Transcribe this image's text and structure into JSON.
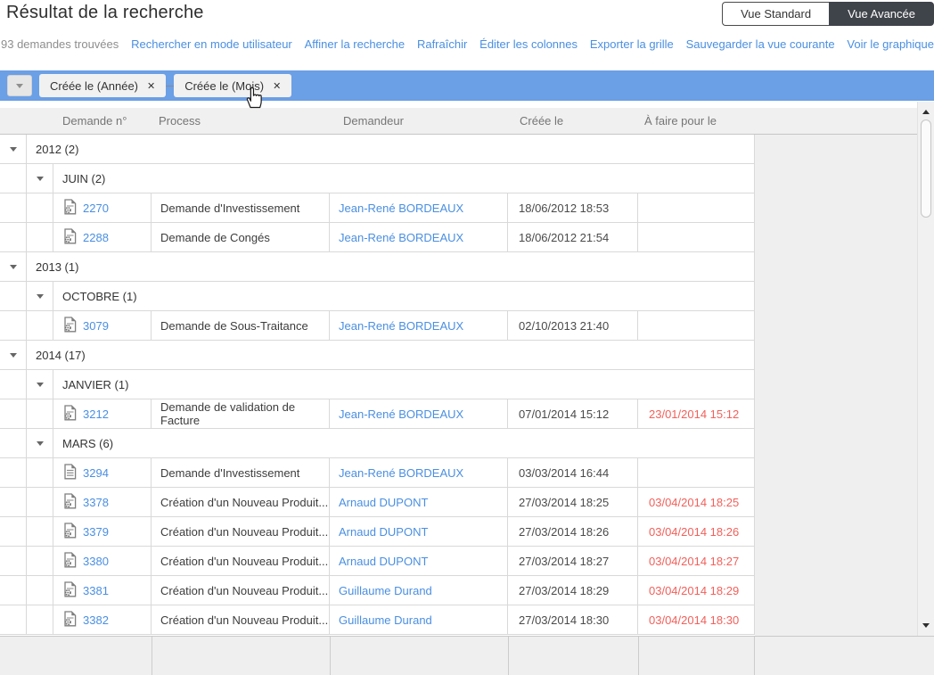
{
  "page": {
    "title": "Résultat de la recherche"
  },
  "view_toggle": {
    "standard": "Vue Standard",
    "advanced": "Vue Avancée"
  },
  "toolbar": {
    "count": "93 demandes trouvées",
    "links": [
      "Rechercher en mode utilisateur",
      "Affiner la recherche",
      "Rafraîchir",
      "Éditer les colonnes",
      "Exporter la grille",
      "Sauvegarder la vue courante",
      "Voir le graphique"
    ]
  },
  "group_bar": {
    "remove_glyph": "✕",
    "chips": [
      {
        "label": "Créée le (Année)"
      },
      {
        "label": "Créée le (Mois)"
      }
    ]
  },
  "table": {
    "columns": [
      "Demande n°",
      "Process",
      "Demandeur",
      "Créée le",
      "À faire pour le"
    ],
    "rows": [
      {
        "type": "year",
        "label": "2012 (2)"
      },
      {
        "type": "month",
        "label": "JUIN (2)"
      },
      {
        "type": "data",
        "icon": "doc-gear",
        "id": "2270",
        "process": "Demande d'Investissement",
        "requester": "Jean-René BORDEAUX",
        "created": "18/06/2012 18:53",
        "due": ""
      },
      {
        "type": "data",
        "icon": "doc-gear",
        "id": "2288",
        "process": "Demande de Congés",
        "requester": "Jean-René BORDEAUX",
        "created": "18/06/2012 21:54",
        "due": ""
      },
      {
        "type": "year",
        "label": "2013 (1)"
      },
      {
        "type": "month",
        "label": "OCTOBRE (1)"
      },
      {
        "type": "data",
        "icon": "doc-gear",
        "id": "3079",
        "process": "Demande de Sous-Traitance",
        "requester": "Jean-René BORDEAUX",
        "created": "02/10/2013 21:40",
        "due": ""
      },
      {
        "type": "year",
        "label": "2014 (17)"
      },
      {
        "type": "month",
        "label": "JANVIER (1)"
      },
      {
        "type": "data",
        "icon": "doc-gear",
        "id": "3212",
        "process": "Demande de validation de Facture",
        "requester": "Jean-René BORDEAUX",
        "created": "07/01/2014 15:12",
        "due": "23/01/2014 15:12"
      },
      {
        "type": "month",
        "label": "MARS (6)"
      },
      {
        "type": "data",
        "icon": "doc-lines",
        "id": "3294",
        "process": "Demande d'Investissement",
        "requester": "Jean-René BORDEAUX",
        "created": "03/03/2014 16:44",
        "due": ""
      },
      {
        "type": "data",
        "icon": "doc-gear",
        "id": "3378",
        "process": "Création d'un Nouveau Produit...",
        "requester": "Arnaud DUPONT",
        "created": "27/03/2014 18:25",
        "due": "03/04/2014 18:25"
      },
      {
        "type": "data",
        "icon": "doc-gear",
        "id": "3379",
        "process": "Création d'un Nouveau Produit...",
        "requester": "Arnaud DUPONT",
        "created": "27/03/2014 18:26",
        "due": "03/04/2014 18:26"
      },
      {
        "type": "data",
        "icon": "doc-gear",
        "id": "3380",
        "process": "Création d'un Nouveau Produit...",
        "requester": "Arnaud DUPONT",
        "created": "27/03/2014 18:27",
        "due": "03/04/2014 18:27"
      },
      {
        "type": "data",
        "icon": "doc-gear",
        "id": "3381",
        "process": "Création d'un Nouveau Produit...",
        "requester": "Guillaume Durand",
        "created": "27/03/2014 18:29",
        "due": "03/04/2014 18:29"
      },
      {
        "type": "data",
        "icon": "doc-gear",
        "id": "3382",
        "process": "Création d'un Nouveau Produit...",
        "requester": "Guillaume Durand",
        "created": "27/03/2014 18:30",
        "due": "03/04/2014 18:30"
      }
    ]
  },
  "colors": {
    "accent_blue_bar": "#6b9fe6",
    "link_blue": "#4a8fe2",
    "overdue_red": "#f2605a",
    "header_gray": "#f0f0f0",
    "dark_button": "#3f434a"
  }
}
